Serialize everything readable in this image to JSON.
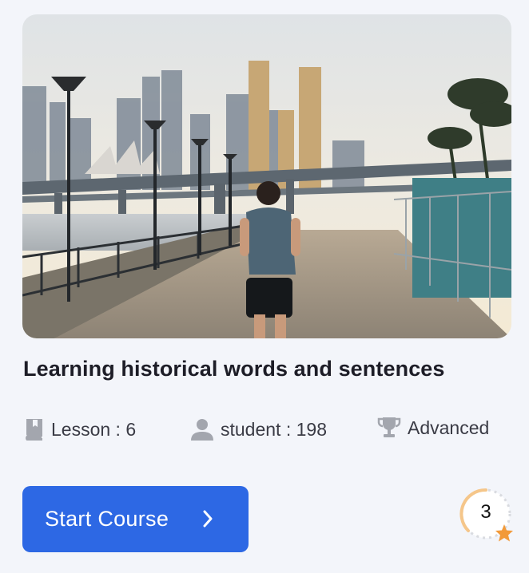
{
  "course": {
    "title": "Learning historical words and sentences",
    "image_icon": "runner-city-promenade-photo",
    "meta": [
      {
        "icon": "book-icon",
        "text": "Lesson : 6"
      },
      {
        "icon": "user-icon",
        "text": "student : 198"
      },
      {
        "icon": "trophy-icon",
        "text": "Advanced"
      }
    ],
    "button": {
      "label": "Start Course",
      "icon": "chevron-right-icon"
    },
    "badge": {
      "value": "3",
      "icon": "star-icon",
      "progress": 0.35
    }
  },
  "colors": {
    "background": "#f3f5fa",
    "button": "#2d68e4",
    "badge_ring": "#f5c68a",
    "star": "#f29a3a",
    "icon_gray": "#a3a6ae"
  }
}
